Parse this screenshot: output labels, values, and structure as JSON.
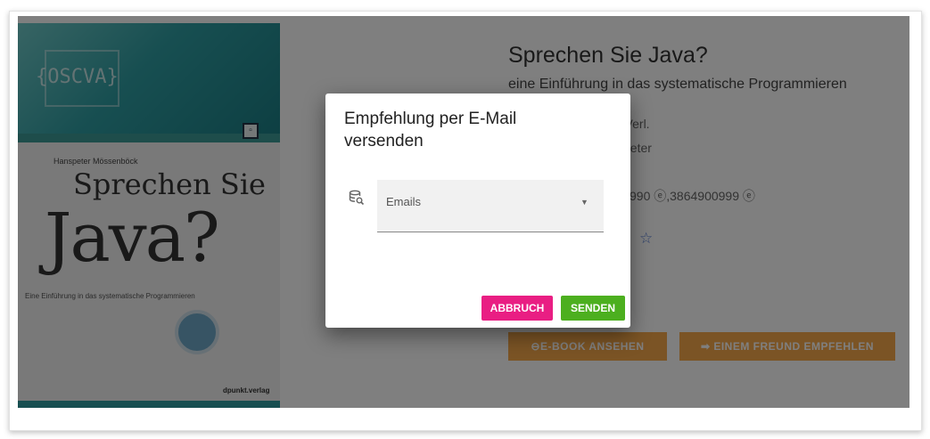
{
  "book": {
    "title": "Sprechen Sie Java?",
    "subtitle": "eine Einführung in das systematische Programmieren",
    "publisher_partial": "t-Verl.",
    "location_partial": "speter",
    "isbn_text": "990 ⓔ,3864900999 ⓔ"
  },
  "cover": {
    "brand_text": "{OSCVA}",
    "author": "Hanspeter Mössenböck",
    "title_line1": "Sprechen Sie",
    "title_line2": "Java?",
    "cover_subtitle": "Eine Einführung in das systematische Programmieren",
    "publisher": "dpunkt.verlag"
  },
  "actions": {
    "ebook_label": "E-BOOK ANSEHEN",
    "friend_label": "EINEM FREUND EMPFEHLEN"
  },
  "modal": {
    "title": "Empfehlung per E-Mail versenden",
    "field_label": "Emails",
    "cancel_label": "ABBRUCH",
    "send_label": "SENDEN"
  },
  "colors": {
    "accent_orange": "#f7a94a",
    "cancel_pink": "#e91e83",
    "send_green": "#4caf1f"
  }
}
